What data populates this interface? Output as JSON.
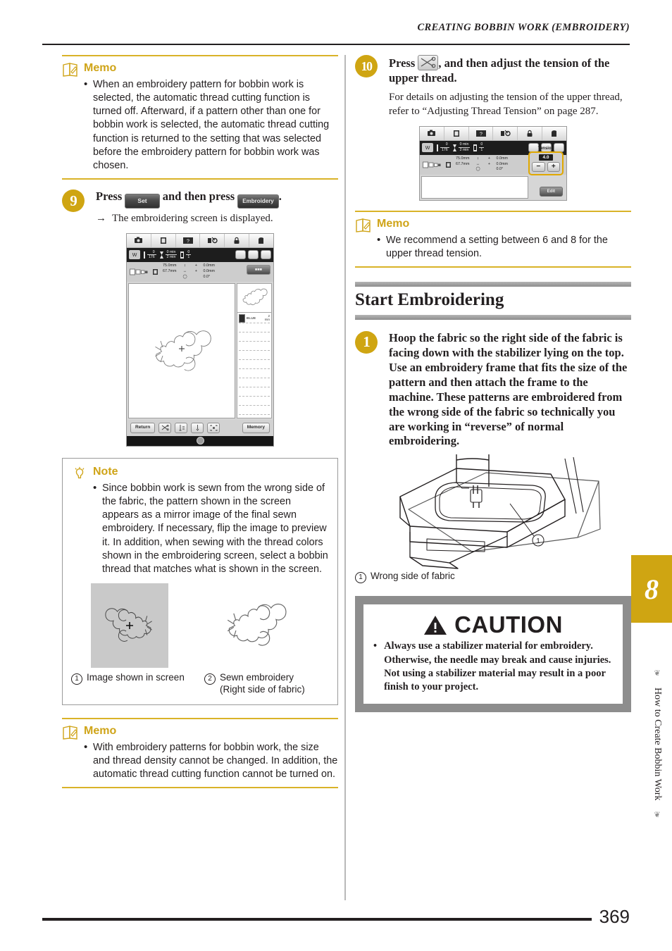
{
  "header": {
    "title": "CREATING BOBBIN WORK (EMBROIDERY)"
  },
  "footer": {
    "page_number": "369"
  },
  "edge_tab": {
    "chapter": "8",
    "vertical_title": "How to Create Bobbin Work"
  },
  "left_column": {
    "memo_top": {
      "title": "Memo",
      "icon": "memo-book-icon",
      "bullets": [
        "When an embroidery pattern for bobbin work is selected, the automatic thread cutting function is turned off. Afterward, if a pattern other than one for bobbin work is selected, the automatic thread cutting function is returned to the setting that was selected before the embroidery pattern for bobbin work was chosen."
      ]
    },
    "step9": {
      "number": "9",
      "text_before": "Press",
      "key_set": "Set",
      "text_middle": "and then press",
      "key_embroidery": "Embroidery",
      "text_after": ".",
      "arrow": "→",
      "result": "The embroidering screen is displayed."
    },
    "embroidery_screen": {
      "toolbar_icons": [
        "camera-icon",
        "page-icon",
        "help-icon",
        "needle-icon",
        "lock-icon",
        "home-icon"
      ],
      "stitch_current": "0",
      "stitch_total": "176",
      "time_current": "0 min",
      "time_total": "2 min",
      "color_current": "0",
      "color_total": "1",
      "size_height": "75.0mm",
      "size_width": "67.7mm",
      "offset_v": "0.0mm",
      "offset_h": "0.0mm",
      "rotation": "0.0°",
      "thread_name": "BLUE",
      "thread_time": "2",
      "thread_time_unit": "min",
      "btn_return": "Return",
      "btn_memory": "Memory",
      "side_buttons": [
        "thread-cut-icon",
        "needle-position-icon",
        "needle-down-icon",
        "trial-frame-icon"
      ]
    },
    "note": {
      "title": "Note",
      "icon": "note-bulb-icon",
      "bullets": [
        "Since bobbin work is sewn from the wrong side of the fabric, the pattern shown in the screen appears as a mirror image of the final sewn embroidery. If necessary, flip the image to preview it. In addition, when sewing with the thread colors shown in the embroidering screen, select a bobbin thread that matches what is shown in the screen."
      ],
      "figures": [
        {
          "number": "①",
          "caption": "Image shown in screen",
          "caption_line2": ""
        },
        {
          "number": "②",
          "caption": "Sewn embroidery",
          "caption_line2": "(Right side of fabric)"
        }
      ]
    },
    "memo_bottom": {
      "title": "Memo",
      "icon": "memo-book-icon",
      "bullets": [
        "With embroidery patterns for bobbin work, the size and thread density cannot be changed. In addition, the automatic thread cutting function cannot be turned on."
      ]
    }
  },
  "right_column": {
    "step10": {
      "number": "10",
      "text_before": "Press",
      "key_icon": "thread-cut-icon",
      "text_after": ", and then adjust the tension of the upper thread.",
      "body": "For details on adjusting the tension of the upper thread, refer to “Adjusting Thread Tension” on page 287."
    },
    "tension_screen": {
      "toolbar_icons": [
        "camera-icon",
        "page-icon",
        "help-icon",
        "needle-icon",
        "lock-icon",
        "home-icon"
      ],
      "stitch_current": "0",
      "stitch_total": "176",
      "time_current": "0 min",
      "time_total": "2 min",
      "color_current": "0",
      "color_total": "1",
      "size_height": "75.0mm",
      "size_width": "67.7mm",
      "offset_v": "0.0mm",
      "offset_h": "0.0mm",
      "rotation": "0.0°",
      "edit_button": "Edit",
      "tension_label": "Tension",
      "tension_value": "4.0",
      "tension_minus": "−",
      "tension_plus": "+"
    },
    "memo": {
      "title": "Memo",
      "icon": "memo-book-icon",
      "bullets": [
        "We recommend a setting between 6 and 8 for the upper thread tension."
      ]
    },
    "section": {
      "title": "Start Embroidering"
    },
    "step1": {
      "number": "1",
      "text": "Hoop the fabric so the right side of the fabric is facing down with the stabilizer lying on the top. Use an embroidery frame that fits the size of the pattern and then attach the frame to the machine. These patterns are embroidered from the wrong side of the fabric so technically you are working in “reverse” of normal embroidering."
    },
    "illustration": {
      "callout_number": "①",
      "caption_number": "①",
      "caption": "Wrong side of fabric"
    },
    "caution": {
      "icon": "warning-triangle-icon",
      "title": "CAUTION",
      "bullet": "•",
      "text": "Always use a stabilizer material for embroidery. Otherwise, the needle may break and cause injuries. Not using a stabilizer material may result in a poor finish to your project."
    }
  }
}
